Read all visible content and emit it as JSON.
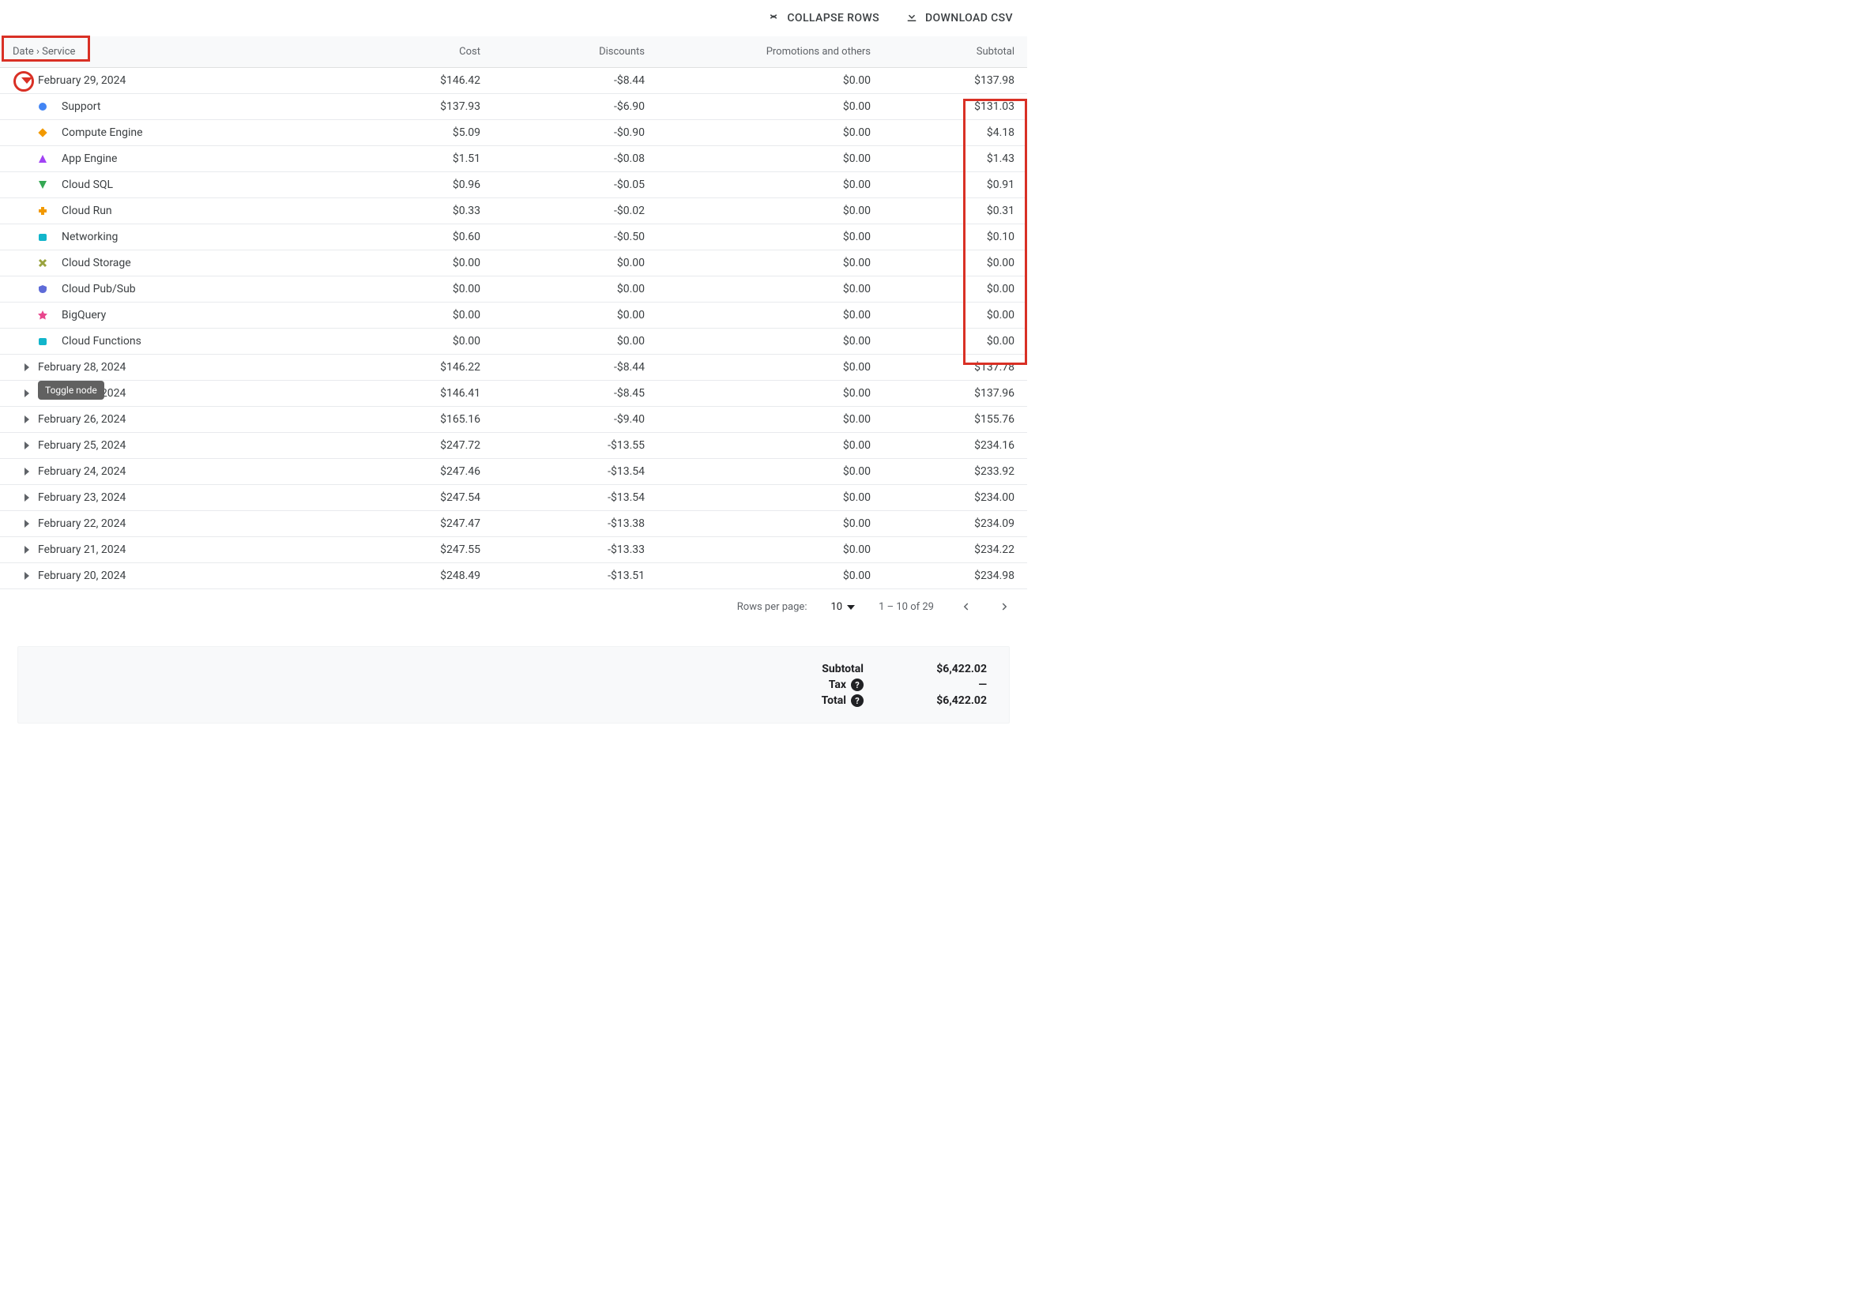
{
  "toolbar": {
    "collapse_label": "COLLAPSE ROWS",
    "download_label": "DOWNLOAD CSV"
  },
  "columns": {
    "group": "Date › Service",
    "cost": "Cost",
    "discounts": "Discounts",
    "promotions": "Promotions and others",
    "subtotal": "Subtotal"
  },
  "expanded_date": {
    "label": "February 29, 2024",
    "cost": "$146.42",
    "discounts": "-$8.44",
    "promotions": "$0.00",
    "subtotal": "$137.98"
  },
  "services": [
    {
      "name": "Support",
      "cost": "$137.93",
      "discounts": "-$6.90",
      "promotions": "$0.00",
      "subtotal": "$131.03",
      "marker_color": "#4285f4",
      "marker_shape": "circle"
    },
    {
      "name": "Compute Engine",
      "cost": "$5.09",
      "discounts": "-$0.90",
      "promotions": "$0.00",
      "subtotal": "$4.18",
      "marker_color": "#f29900",
      "marker_shape": "diamond"
    },
    {
      "name": "App Engine",
      "cost": "$1.51",
      "discounts": "-$0.08",
      "promotions": "$0.00",
      "subtotal": "$1.43",
      "marker_color": "#a142f4",
      "marker_shape": "triangle-up"
    },
    {
      "name": "Cloud SQL",
      "cost": "$0.96",
      "discounts": "-$0.05",
      "promotions": "$0.00",
      "subtotal": "$0.91",
      "marker_color": "#34a853",
      "marker_shape": "triangle-down"
    },
    {
      "name": "Cloud Run",
      "cost": "$0.33",
      "discounts": "-$0.02",
      "promotions": "$0.00",
      "subtotal": "$0.31",
      "marker_color": "#f29900",
      "marker_shape": "plus"
    },
    {
      "name": "Networking",
      "cost": "$0.60",
      "discounts": "-$0.50",
      "promotions": "$0.00",
      "subtotal": "$0.10",
      "marker_color": "#12b5cb",
      "marker_shape": "square-round"
    },
    {
      "name": "Cloud Storage",
      "cost": "$0.00",
      "discounts": "$0.00",
      "promotions": "$0.00",
      "subtotal": "$0.00",
      "marker_color": "#9aa33f",
      "marker_shape": "x"
    },
    {
      "name": "Cloud Pub/Sub",
      "cost": "$0.00",
      "discounts": "$0.00",
      "promotions": "$0.00",
      "subtotal": "$0.00",
      "marker_color": "#5e6bd8",
      "marker_shape": "shield"
    },
    {
      "name": "BigQuery",
      "cost": "$0.00",
      "discounts": "$0.00",
      "promotions": "$0.00",
      "subtotal": "$0.00",
      "marker_color": "#e8468d",
      "marker_shape": "star"
    },
    {
      "name": "Cloud Functions",
      "cost": "$0.00",
      "discounts": "$0.00",
      "promotions": "$0.00",
      "subtotal": "$0.00",
      "marker_color": "#12b5cb",
      "marker_shape": "square-round"
    }
  ],
  "collapsed_dates": [
    {
      "label": "February 28, 2024",
      "cost": "$146.22",
      "discounts": "-$8.44",
      "promotions": "$0.00",
      "subtotal": "$137.78"
    },
    {
      "label": "February 27, 2024",
      "cost": "$146.41",
      "discounts": "-$8.45",
      "promotions": "$0.00",
      "subtotal": "$137.96"
    },
    {
      "label": "February 26, 2024",
      "cost": "$165.16",
      "discounts": "-$9.40",
      "promotions": "$0.00",
      "subtotal": "$155.76"
    },
    {
      "label": "February 25, 2024",
      "cost": "$247.72",
      "discounts": "-$13.55",
      "promotions": "$0.00",
      "subtotal": "$234.16"
    },
    {
      "label": "February 24, 2024",
      "cost": "$247.46",
      "discounts": "-$13.54",
      "promotions": "$0.00",
      "subtotal": "$233.92"
    },
    {
      "label": "February 23, 2024",
      "cost": "$247.54",
      "discounts": "-$13.54",
      "promotions": "$0.00",
      "subtotal": "$234.00"
    },
    {
      "label": "February 22, 2024",
      "cost": "$247.47",
      "discounts": "-$13.38",
      "promotions": "$0.00",
      "subtotal": "$234.09"
    },
    {
      "label": "February 21, 2024",
      "cost": "$247.55",
      "discounts": "-$13.33",
      "promotions": "$0.00",
      "subtotal": "$234.22"
    },
    {
      "label": "February 20, 2024",
      "cost": "$248.49",
      "discounts": "-$13.51",
      "promotions": "$0.00",
      "subtotal": "$234.98"
    }
  ],
  "tooltip": "Toggle node",
  "pagination": {
    "rows_label": "Rows per page:",
    "rows_value": "10",
    "range": "1 – 10 of 29"
  },
  "summary": {
    "subtotal_label": "Subtotal",
    "subtotal_value": "$6,422.02",
    "tax_label": "Tax",
    "tax_value": "—",
    "total_label": "Total",
    "total_value": "$6,422.02"
  }
}
